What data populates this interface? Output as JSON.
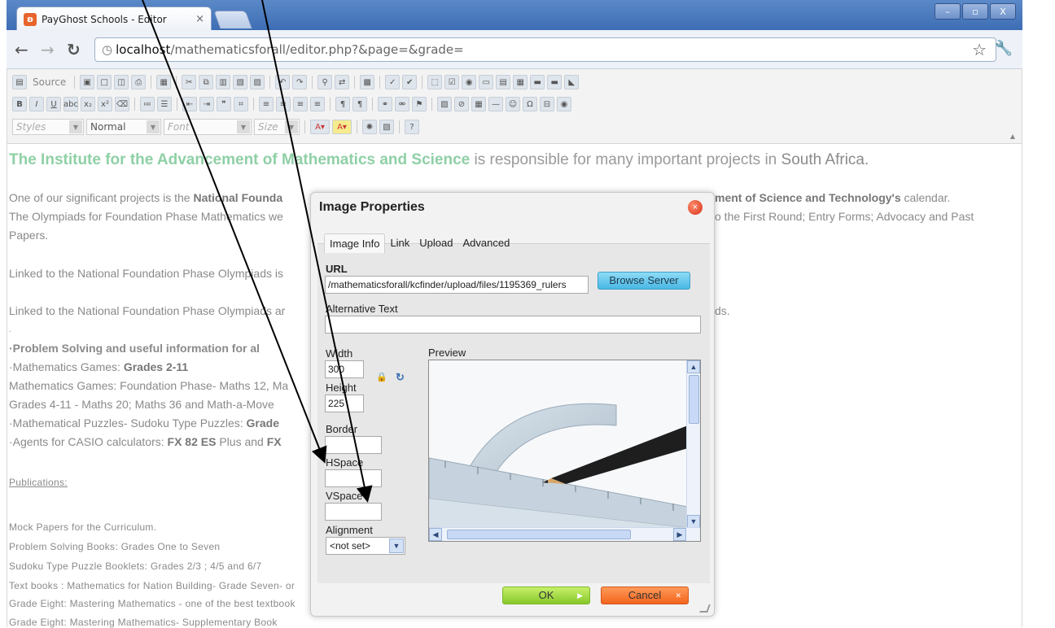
{
  "browser": {
    "tab_title": "PayGhost Schools - Editor",
    "tab_close": "×",
    "url_host": "localhost",
    "url_path": "/mathematicsforall/editor.php?&page=&grade=",
    "win_min": "–",
    "win_max": "▫",
    "win_close": "X"
  },
  "toolbar": {
    "source_label": "Source",
    "styles_combo": "Styles",
    "format_combo": "Normal",
    "font_combo": "Font",
    "size_combo": "Size"
  },
  "content": {
    "headline_green": "The Institute for the Advancement of Mathematics and Science",
    "headline_gray": " is responsible for many important projects in ",
    "headline_sa": "South Africa.",
    "p1_line1_a": "One of our significant projects is the ",
    "p1_line1_b": "National Founda",
    "p1_line1_right_b": "ment of Science and Technology's",
    "p1_line1_right_c": " calendar.",
    "p1_line2": "The Olympiads for Foundation Phase Mathematics we",
    "p1_line2_right": "o the First Round; Entry Forms; Advocacy and Past",
    "p1_line3": "Papers.",
    "p2": "Linked to the National Foundation Phase Olympiads is",
    "p3": "Linked to the National Foundation Phase Olympiads ar",
    "p3_right": "ds.",
    "dot": ".",
    "ps_heading": "·Problem Solving and useful information for al",
    "games_a": "·Mathematics Games: ",
    "games_b": "Grades 2-11",
    "games_fp": "Mathematics Games: Foundation Phase- Maths 12, Ma",
    "games_411": "Grades 4-11 - Maths 20; Maths 36 and Math-a-Move",
    "puzzles_a": "·Mathematical Puzzles- Sudoku Type Puzzles: ",
    "puzzles_b": "Grade",
    "casio_a": "·Agents for CASIO calculators: ",
    "casio_b": "FX 82 ES",
    "casio_c": " Plus and ",
    "casio_d": "FX",
    "publications": "Publications:",
    "pub1": "Mock Papers for the Curriculum.",
    "pub2": "Problem Solving Books: Grades One to Seven",
    "pub3": "Sudoku Type Puzzle Booklets: Grades 2/3 ; 4/5 and 6/7",
    "pub4": "Text books : Mathematics for Nation Building- Grade Seven- or",
    "pub5": "Grade Eight: Mastering Mathematics - one of the best textbook",
    "pub6": "Grade Eight: Mastering Mathematics- Supplementary Book"
  },
  "dialog": {
    "title": "Image Properties",
    "close": "×",
    "tabs": [
      "Image Info",
      "Link",
      "Upload",
      "Advanced"
    ],
    "url_label": "URL",
    "url_value": "/mathematicsforall/kcfinder/upload/files/1195369_rulers",
    "browse_label": "Browse Server",
    "alt_label": "Alternative Text",
    "alt_value": "",
    "width_label": "Width",
    "width_value": "300",
    "height_label": "Height",
    "height_value": "225",
    "border_label": "Border",
    "hspace_label": "HSpace",
    "vspace_label": "VSpace",
    "alignment_label": "Alignment",
    "alignment_value": "<not set>",
    "preview_label": "Preview",
    "ok_label": "OK",
    "cancel_label": "Cancel"
  },
  "colors": {
    "headline_green": "#8fd0a6",
    "ok_green": "#86c82a",
    "cancel_orange": "#f2641c",
    "browse_blue": "#48b7e4"
  }
}
